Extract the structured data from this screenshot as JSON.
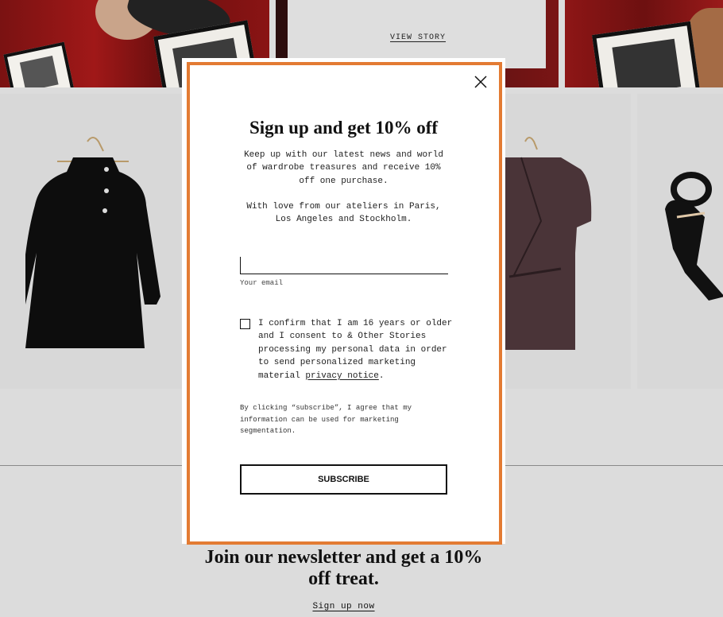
{
  "background": {
    "view_story_label": "VIEW STORY",
    "newsletter_heading": "Join our newsletter and get a 10% off treat.",
    "signup_link_label": "Sign up now"
  },
  "modal": {
    "title": "Sign up and get 10% off",
    "body_paragraph_1": "Keep up with our latest news and world of wardrobe treasures and receive 10% off one purchase.",
    "body_paragraph_2": "With love from our ateliers in Paris, Los Angeles and Stockholm.",
    "email_value": "",
    "email_label": "Your email",
    "consent_text": "I confirm that I am 16 years or older and I consent to & Other Stories processing my personal data in order to send personalized marketing material",
    "privacy_link_label": "privacy notice",
    "consent_suffix": ".",
    "disclaimer": "By clicking “subscribe”, I agree that my information can be used for marketing segmentation.",
    "subscribe_label": "SUBSCRIBE",
    "close_icon": "close-icon",
    "accent_color": "#e37b33"
  }
}
